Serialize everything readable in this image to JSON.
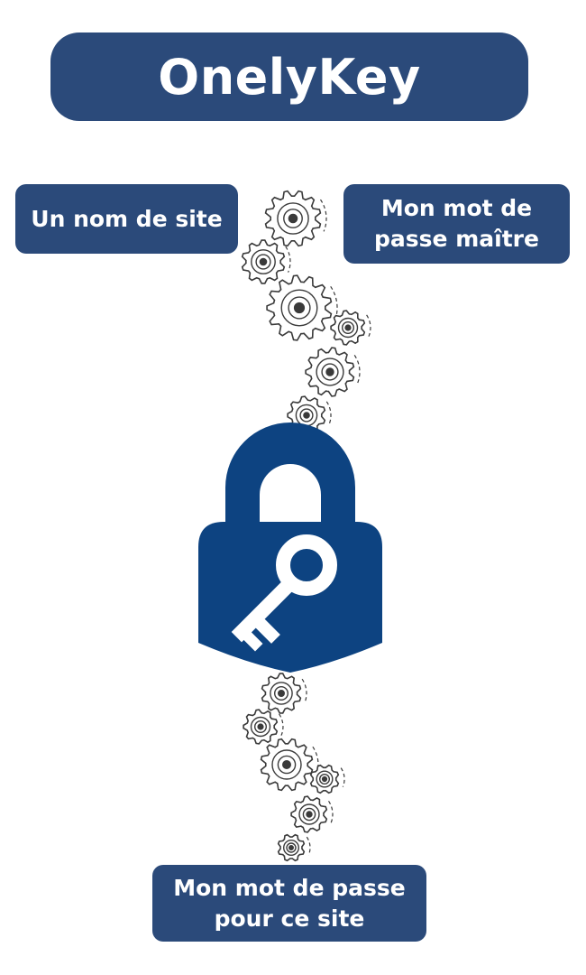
{
  "title": "OnelyKey",
  "inputs": {
    "site_name": "Un nom de site",
    "master_password": [
      "Mon mot de",
      "passe maître"
    ]
  },
  "output": {
    "site_password": [
      "Mon mot de passe",
      "pour ce site"
    ]
  },
  "icons": [
    "gears-icon",
    "padlock-key-icon"
  ],
  "colors": {
    "box_blue": "#2b4a7a",
    "lock_blue": "#0d4381",
    "gear_stroke": "#3a3a3a",
    "text": "#ffffff"
  }
}
